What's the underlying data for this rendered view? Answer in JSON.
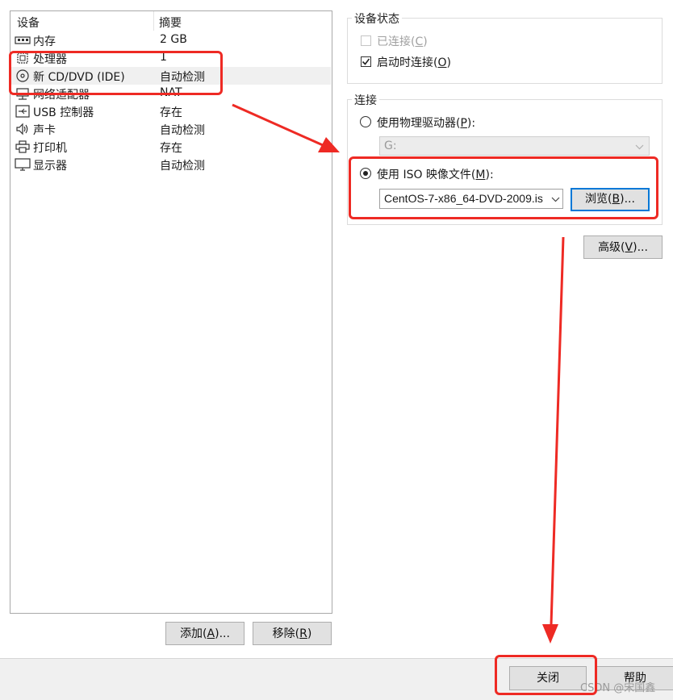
{
  "device_list": {
    "header_device": "设备",
    "header_summary": "摘要",
    "items": [
      {
        "name": "内存",
        "summary": "2 GB",
        "icon": "memory-icon"
      },
      {
        "name": "处理器",
        "summary": "1",
        "icon": "processor-icon"
      },
      {
        "name": "新 CD/DVD (IDE)",
        "summary": "自动检测",
        "icon": "cd-dvd-icon"
      },
      {
        "name": "网络适配器",
        "summary": "NAT",
        "icon": "network-adapter-icon"
      },
      {
        "name": "USB 控制器",
        "summary": "存在",
        "icon": "usb-icon"
      },
      {
        "name": "声卡",
        "summary": "自动检测",
        "icon": "speaker-icon"
      },
      {
        "name": "打印机",
        "summary": "存在",
        "icon": "printer-icon"
      },
      {
        "name": "显示器",
        "summary": "自动检测",
        "icon": "monitor-icon"
      }
    ],
    "add_label": "添加(",
    "add_key": "A",
    "add_tail": ")...",
    "remove_label": "移除(",
    "remove_key": "R",
    "remove_tail": ")"
  },
  "device_status": {
    "title": "设备状态",
    "connected_label": "已连接(",
    "connected_key": "C",
    "connected_tail": ")",
    "connected_checked": false,
    "connect_at_power_on_label": "启动时连接(",
    "connect_at_power_on_key": "O",
    "connect_at_power_on_tail": ")",
    "connect_at_power_on_checked": true
  },
  "connection": {
    "title": "连接",
    "physical_label": "使用物理驱动器(",
    "physical_key": "P",
    "physical_tail": "):",
    "physical_drive_value": "G:",
    "iso_label": "使用 ISO 映像文件(",
    "iso_key": "M",
    "iso_tail": "):",
    "iso_path": "CentOS-7-x86_64-DVD-2009.is",
    "browse_label": "浏览(",
    "browse_key": "B",
    "browse_tail": ")...",
    "selected": "iso"
  },
  "advanced": {
    "label": "高级(",
    "key": "V",
    "tail": ")..."
  },
  "footer": {
    "close_label": "关闭",
    "help_label": "帮助"
  },
  "watermark": "CSDN @宋国鑫",
  "colors": {
    "annotation_red": "#ee2a24",
    "selected_row": "#f0f0f0",
    "focused_button_border": "#0078d7"
  }
}
